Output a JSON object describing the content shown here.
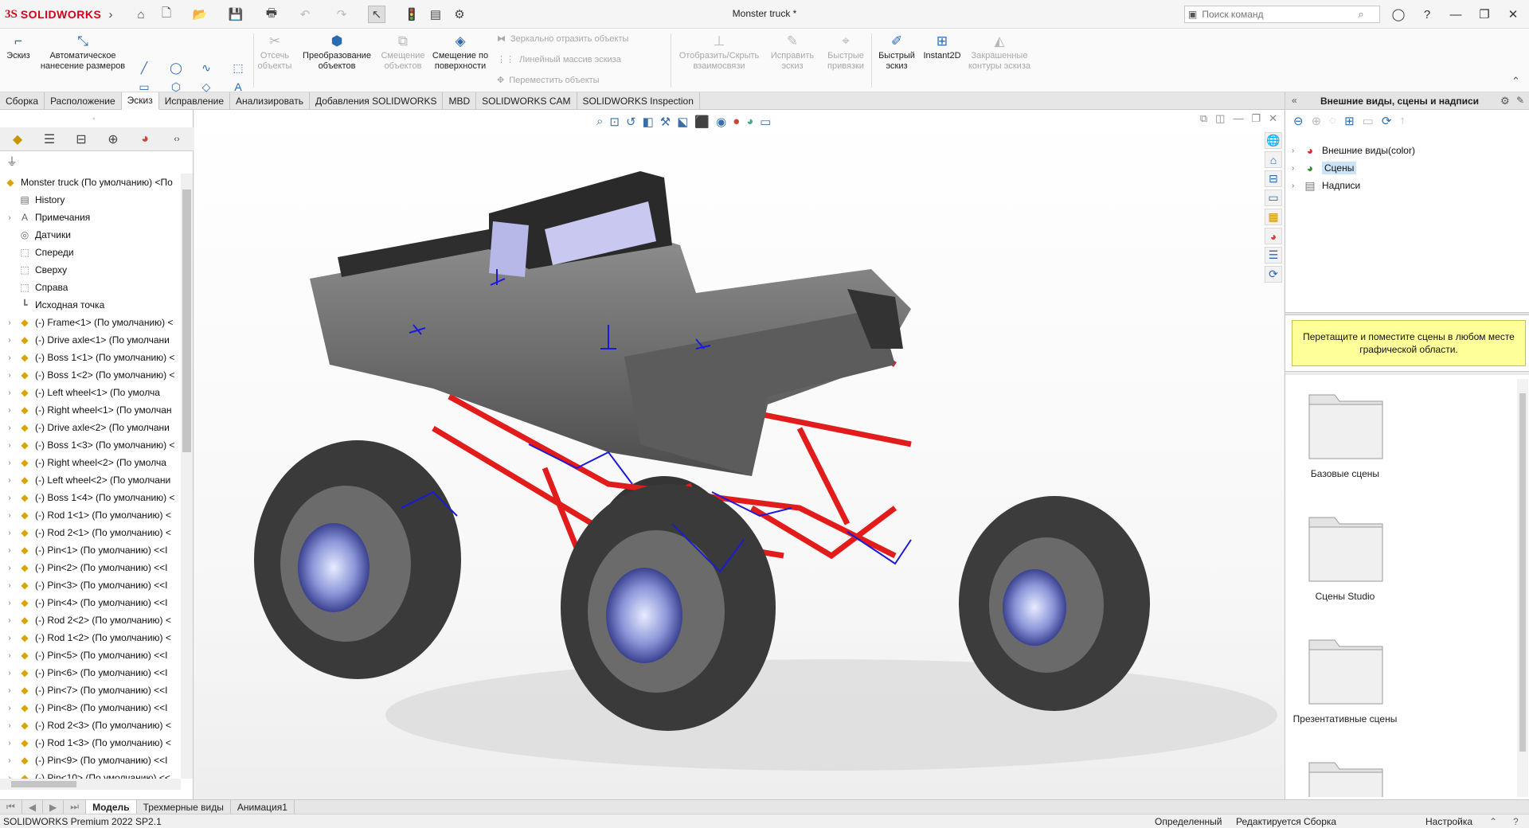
{
  "app": {
    "logo_ds": "3S",
    "logo_name": "SOLIDWORKS",
    "document_title": "Monster truck *"
  },
  "search": {
    "placeholder": "Поиск команд"
  },
  "ribbon": {
    "sketch": "Эскиз",
    "auto_dim": "Автоматическое нанесение размеров",
    "trim": "Отсечь объекты",
    "convert": "Преобразование объектов",
    "offset": "Смещение объектов",
    "offset_surface": "Смещение по поверхности",
    "mirror": "Зеркально отразить объекты",
    "linear_pattern": "Линейный массив эскиза",
    "move": "Переместить объекты",
    "show_hide": "Отобразить/Скрыть взаимосвязи",
    "repair": "Исправить эскиз",
    "snaps": "Быстрые привязки",
    "rapid_sketch": "Быстрый эскиз",
    "instant2d": "Instant2D",
    "shaded": "Закрашенные контуры эскиза"
  },
  "tabs": [
    "Сборка",
    "Расположение",
    "Эскиз",
    "Исправление",
    "Анализировать",
    "Добавления SOLIDWORKS",
    "MBD",
    "SOLIDWORKS CAM",
    "SOLIDWORKS Inspection"
  ],
  "tree": {
    "root": "Monster truck  (По умолчанию) <По",
    "items": [
      {
        "label": "History",
        "icon": "history-icon",
        "expand": false
      },
      {
        "label": "Примечания",
        "icon": "annotations-icon",
        "expand": true
      },
      {
        "label": "Датчики",
        "icon": "sensors-icon",
        "expand": false
      },
      {
        "label": "Спереди",
        "icon": "plane-icon",
        "expand": false
      },
      {
        "label": "Сверху",
        "icon": "plane-icon",
        "expand": false
      },
      {
        "label": "Справа",
        "icon": "plane-icon",
        "expand": false
      },
      {
        "label": "Исходная точка",
        "icon": "origin-icon",
        "expand": false
      },
      {
        "label": "(-) Frame<1> (По умолчанию) <",
        "icon": "part-icon",
        "expand": true
      },
      {
        "label": "(-) Drive axle<1> (По умолчани",
        "icon": "part-icon",
        "expand": true
      },
      {
        "label": "(-) Boss 1<1> (По умолчанию) <",
        "icon": "part-icon",
        "expand": true
      },
      {
        "label": "(-) Boss 1<2> (По умолчанию) <",
        "icon": "part-icon",
        "expand": true
      },
      {
        "label": "(-) Left wheel<1> (По умолча",
        "icon": "part-icon",
        "expand": true
      },
      {
        "label": "(-) Right wheel<1> (По умолчан",
        "icon": "part-icon",
        "expand": true
      },
      {
        "label": "(-) Drive axle<2> (По умолчани",
        "icon": "part-icon",
        "expand": true
      },
      {
        "label": "(-) Boss 1<3> (По умолчанию) <",
        "icon": "part-icon",
        "expand": true
      },
      {
        "label": "(-) Right wheel<2> (По умолча",
        "icon": "part-icon",
        "expand": true
      },
      {
        "label": "(-) Left wheel<2> (По умолчани",
        "icon": "part-icon",
        "expand": true
      },
      {
        "label": "(-) Boss 1<4> (По умолчанию) <",
        "icon": "part-icon",
        "expand": true
      },
      {
        "label": "(-) Rod 1<1> (По умолчанию) <",
        "icon": "part-icon",
        "expand": true
      },
      {
        "label": "(-) Rod 2<1> (По умолчанию) <",
        "icon": "part-icon",
        "expand": true
      },
      {
        "label": "(-) Pin<1> (По умолчанию) <<I",
        "icon": "part-icon",
        "expand": true
      },
      {
        "label": "(-) Pin<2> (По умолчанию) <<I",
        "icon": "part-icon",
        "expand": true
      },
      {
        "label": "(-) Pin<3> (По умолчанию) <<I",
        "icon": "part-icon",
        "expand": true
      },
      {
        "label": "(-) Pin<4> (По умолчанию) <<I",
        "icon": "part-icon",
        "expand": true
      },
      {
        "label": "(-) Rod 2<2> (По умолчанию) <",
        "icon": "part-icon",
        "expand": true
      },
      {
        "label": "(-) Rod 1<2> (По умолчанию) <",
        "icon": "part-icon",
        "expand": true
      },
      {
        "label": "(-) Pin<5> (По умолчанию) <<I",
        "icon": "part-icon",
        "expand": true
      },
      {
        "label": "(-) Pin<6> (По умолчанию) <<I",
        "icon": "part-icon",
        "expand": true
      },
      {
        "label": "(-) Pin<7> (По умолчанию) <<I",
        "icon": "part-icon",
        "expand": true
      },
      {
        "label": "(-) Pin<8> (По умолчанию) <<I",
        "icon": "part-icon",
        "expand": true
      },
      {
        "label": "(-) Rod 2<3> (По умолчанию) <",
        "icon": "part-icon",
        "expand": true
      },
      {
        "label": "(-) Rod 1<3> (По умолчанию) <",
        "icon": "part-icon",
        "expand": true
      },
      {
        "label": "(-) Pin<9> (По умолчанию) <<I",
        "icon": "part-icon",
        "expand": true
      },
      {
        "label": "(-) Pin<10> (По умолчанию) <<",
        "icon": "part-icon",
        "expand": true
      }
    ]
  },
  "right_panel": {
    "title": "Внешние виды, сцены и надписи",
    "tree": [
      {
        "label": "Внешние виды(color)",
        "icon": "appearance-icon"
      },
      {
        "label": "Сцены",
        "icon": "scenes-icon"
      },
      {
        "label": "Надписи",
        "icon": "decals-icon"
      }
    ],
    "hint": "Перетащите и поместите сцены в любом месте графической области.",
    "folders": [
      "Базовые сцены",
      "Сцены Studio",
      "Презентативные сцены"
    ]
  },
  "bottom_tabs": [
    "Модель",
    "Трехмерные виды",
    "Анимация1"
  ],
  "status": {
    "version": "SOLIDWORKS Premium 2022 SP2.1",
    "definition": "Определенный",
    "mode": "Редактируется Сборка",
    "settings": "Настройка"
  },
  "colors": {
    "brand": "#d0021b",
    "accent": "#2a6ab3",
    "hint_bg": "#ffff99"
  }
}
